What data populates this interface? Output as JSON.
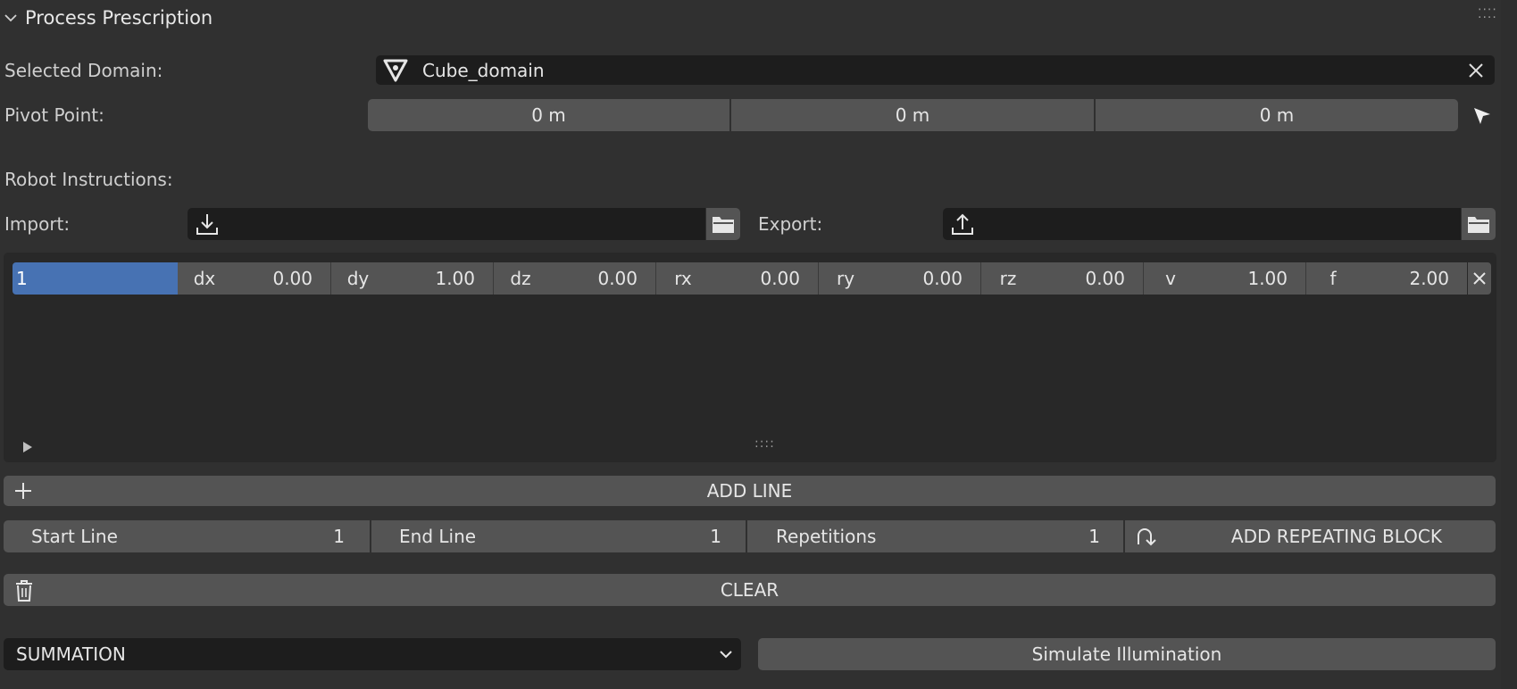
{
  "panel": {
    "title": "Process Prescription"
  },
  "domain": {
    "label": "Selected Domain:",
    "value": "Cube_domain"
  },
  "pivot": {
    "label": "Pivot Point:",
    "x": "0 m",
    "y": "0 m",
    "z": "0 m"
  },
  "robot": {
    "label": "Robot Instructions:"
  },
  "import": {
    "label": "Import:",
    "value": ""
  },
  "export": {
    "label": "Export:",
    "value": ""
  },
  "instruction": {
    "index": "1",
    "fields": [
      {
        "key": "dx",
        "value": "0.00"
      },
      {
        "key": "dy",
        "value": "1.00"
      },
      {
        "key": "dz",
        "value": "0.00"
      },
      {
        "key": "rx",
        "value": "0.00"
      },
      {
        "key": "ry",
        "value": "0.00"
      },
      {
        "key": "rz",
        "value": "0.00"
      },
      {
        "key": "v",
        "value": "1.00"
      },
      {
        "key": "f",
        "value": "2.00"
      }
    ]
  },
  "list": {
    "grip": "::::"
  },
  "add_line": {
    "label": "ADD LINE"
  },
  "block": {
    "start_label": "Start Line",
    "start_value": "1",
    "end_label": "End Line",
    "end_value": "1",
    "rep_label": "Repetitions",
    "rep_value": "1",
    "add_label": "ADD REPEATING BLOCK"
  },
  "clear": {
    "label": "CLEAR"
  },
  "mode": {
    "value": "SUMMATION"
  },
  "simulate": {
    "label": "Simulate Illumination"
  }
}
